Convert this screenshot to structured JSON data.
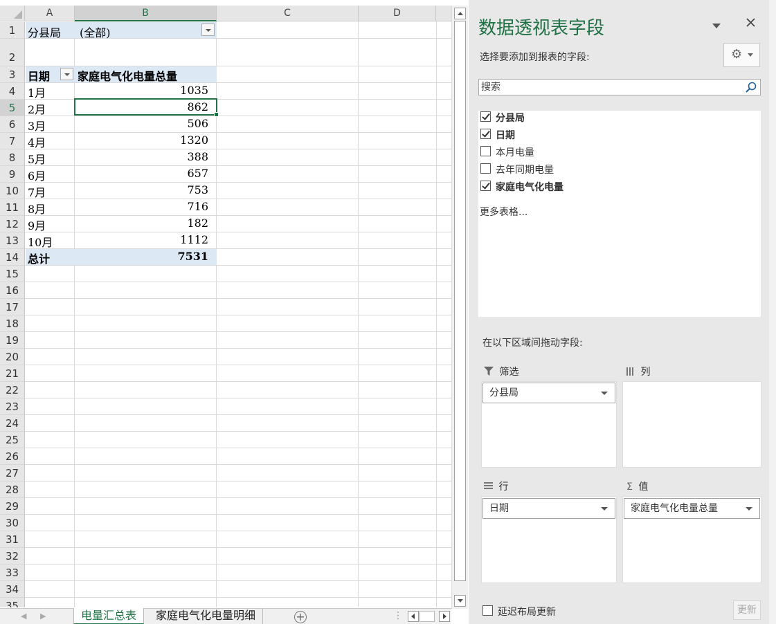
{
  "columns": [
    "A",
    "B",
    "C",
    "D"
  ],
  "selected_column": "B",
  "rows": [
    "1",
    "2",
    "3",
    "4",
    "5",
    "6",
    "7",
    "8",
    "9",
    "10",
    "11",
    "12",
    "13",
    "14",
    "15",
    "16",
    "17",
    "18",
    "19",
    "20",
    "21",
    "22",
    "23",
    "24",
    "25",
    "26",
    "27",
    "28",
    "29",
    "30",
    "31",
    "32",
    "33",
    "34",
    "35"
  ],
  "selected_row": "5",
  "pivot": {
    "filter_label": "分县局",
    "filter_value": "(全部)",
    "row_header": "日期",
    "value_header": "家庭电气化电量总量",
    "rows": [
      {
        "label": "1月",
        "value": "1035"
      },
      {
        "label": "2月",
        "value": "862"
      },
      {
        "label": "3月",
        "value": "506"
      },
      {
        "label": "4月",
        "value": "1320"
      },
      {
        "label": "5月",
        "value": "388"
      },
      {
        "label": "6月",
        "value": "657"
      },
      {
        "label": "7月",
        "value": "753"
      },
      {
        "label": "8月",
        "value": "716"
      },
      {
        "label": "9月",
        "value": "182"
      },
      {
        "label": "10月",
        "value": "1112"
      }
    ],
    "total_label": "总计",
    "total_value": "7531"
  },
  "sheet_tabs": [
    {
      "label": "电量汇总表",
      "active": true
    },
    {
      "label": "家庭电气化电量明细",
      "active": false
    }
  ],
  "tab_nav": [
    "◀",
    "▶"
  ],
  "add_sheet_symbol": "+",
  "panel": {
    "title": "数据透视表字段",
    "subtitle": "选择要添加到报表的字段:",
    "search_placeholder": "搜索",
    "fields": [
      {
        "label": "分县局",
        "checked": true
      },
      {
        "label": "日期",
        "checked": true
      },
      {
        "label": "本月电量",
        "checked": false
      },
      {
        "label": "去年同期电量",
        "checked": false
      },
      {
        "label": "家庭电气化电量",
        "checked": true
      }
    ],
    "more_tables": "更多表格...",
    "drag_hint": "在以下区域间拖动字段:",
    "areas": {
      "filters": {
        "label": "筛选",
        "items": [
          "分县局"
        ]
      },
      "columns": {
        "label": "列",
        "items": []
      },
      "rows": {
        "label": "行",
        "items": [
          "日期"
        ]
      },
      "values": {
        "label": "值",
        "items": [
          "家庭电气化电量总量"
        ]
      }
    },
    "defer_label": "延迟布局更新",
    "update_label": "更新",
    "icons": [
      "dropdown-icon",
      "close-icon",
      "gear-icon",
      "search-icon",
      "filter-icon",
      "columns-icon",
      "rows-icon",
      "sigma-icon"
    ]
  },
  "colors": {
    "accent": "#217346",
    "pivot_shade": "#dce9f5",
    "panel_bg": "#e8e8e8"
  }
}
